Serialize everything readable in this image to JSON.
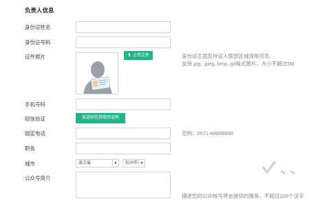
{
  "section_title": "负责人信息",
  "fields": {
    "name_label": "身份证姓名",
    "id_label": "身份证号码",
    "photo_label": "证件照片",
    "phone_label": "手机号码",
    "sms_label": "短信验证",
    "landline_label": "固定电话",
    "position_label": "职务",
    "city_label": "城市",
    "intro_label": "公众号简介"
  },
  "upload": {
    "button_label": "上传文件",
    "icon": "upload-arrow-icon"
  },
  "photo_hint": {
    "line1": "身份证正面及持证人面部区域清晰可见,",
    "line2": "支持.jpg, .jpeg,.bmp,.gif格式图片，大小不超过5M"
  },
  "sms": {
    "button_label": "发送短信获取验证码"
  },
  "landline_hint": "范例：0571-88888888",
  "city": {
    "province": "浙江省",
    "city": "杭州市"
  },
  "intro_hint": "描述您的公众帐号将会提供的服务，不超过200个汉字",
  "watermark": "✓ 、、",
  "colors": {
    "accent": "#23b38a"
  }
}
